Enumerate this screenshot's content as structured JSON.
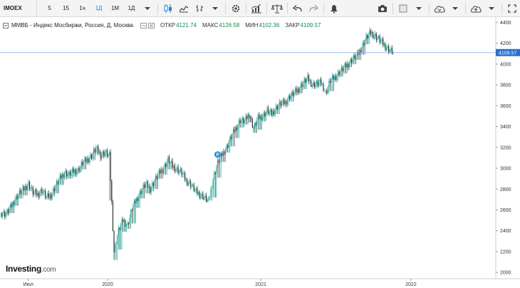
{
  "toolbar": {
    "symbol": "IMOEX",
    "timeframes": [
      {
        "label": "5",
        "active": false
      },
      {
        "label": "15",
        "active": false
      },
      {
        "label": "1ч",
        "active": false
      },
      {
        "label": "1Д",
        "active": true
      },
      {
        "label": "1М",
        "active": false
      },
      {
        "label": "1Д",
        "active": false
      }
    ],
    "tools_left": [
      "candles-icon",
      "area-icon",
      "bars-icon",
      "gear-icon",
      "indicators-icon",
      "scales-icon",
      "undo-icon",
      "redo-icon",
      "alert-icon"
    ],
    "tools_right": [
      "camera-icon",
      "color-box-icon",
      "cloud-icon",
      "cloud-upload-icon",
      "fullscreen-icon"
    ]
  },
  "legend": {
    "title": "ММВБ - Индекс Мосбиржи, Россия, Д, Москва",
    "open_label": "ОТКР",
    "open": "4121.74",
    "high_label": "МАКС",
    "high": "4126.58",
    "low_label": "МИН",
    "low": "4102.36",
    "close_label": "ЗАКР",
    "close": "4109.57"
  },
  "logo": {
    "name": "Investing",
    "suffix": ".com"
  },
  "colors": {
    "up": "#26a69a",
    "down": "#333333",
    "price_line": "#7fa7e0",
    "price_tag": "#2a6fcf"
  },
  "chart_data": {
    "type": "candlestick",
    "ylim": [
      1940,
      4450
    ],
    "yticks": [
      2000,
      2200,
      2400,
      2600,
      2800,
      3000,
      3200,
      3400,
      3600,
      3800,
      4000,
      4200,
      4400
    ],
    "x_labels": [
      {
        "label": "Июл",
        "pos": 0.057
      },
      {
        "label": "2020",
        "pos": 0.217
      },
      {
        "label": "2021",
        "pos": 0.526
      },
      {
        "label": "2022",
        "pos": 0.829
      }
    ],
    "last_price": 4109.57,
    "event_marker": "P",
    "event_marker_index": 48,
    "closes": [
      2570,
      2560,
      2620,
      2700,
      2760,
      2800,
      2850,
      2770,
      2750,
      2790,
      2720,
      2740,
      2830,
      2900,
      2960,
      2940,
      2970,
      2980,
      3050,
      3080,
      3120,
      3190,
      3130,
      3150,
      3120,
      2200,
      2400,
      2500,
      2450,
      2610,
      2700,
      2780,
      2850,
      2800,
      2880,
      2950,
      3000,
      3080,
      3020,
      2990,
      2960,
      2880,
      2850,
      2780,
      2750,
      2720,
      2680,
      2900,
      3050,
      3130,
      3200,
      3300,
      3380,
      3460,
      3450,
      3520,
      3380,
      3480,
      3500,
      3550,
      3520,
      3580,
      3620,
      3630,
      3690,
      3720,
      3760,
      3820,
      3860,
      3800,
      3810,
      3820,
      3720,
      3840,
      3870,
      3920,
      3960,
      4000,
      4050,
      4080,
      4160,
      4250,
      4300,
      4270,
      4230,
      4180,
      4140,
      4110
    ],
    "lows": [
      2500,
      2510,
      2530,
      2600,
      2670,
      2700,
      2740,
      2700,
      2690,
      2700,
      2660,
      2690,
      2720,
      2800,
      2860,
      2860,
      2880,
      2920,
      2950,
      3010,
      3040,
      3090,
      3060,
      3070,
      2650,
      2080,
      2180,
      2350,
      2380,
      2430,
      2580,
      2670,
      2720,
      2740,
      2760,
      2860,
      2900,
      2950,
      2940,
      2920,
      2870,
      2820,
      2790,
      2720,
      2700,
      2670,
      2650,
      2680,
      2870,
      3020,
      3110,
      3170,
      3250,
      3350,
      3380,
      3400,
      3300,
      3330,
      3410,
      3470,
      3460,
      3480,
      3560,
      3560,
      3600,
      3660,
      3680,
      3720,
      3790,
      3760,
      3740,
      3750,
      3680,
      3700,
      3800,
      3840,
      3870,
      3930,
      3960,
      4000,
      4050,
      4150,
      4220,
      4200,
      4150,
      4120,
      4090,
      4080
    ]
  }
}
